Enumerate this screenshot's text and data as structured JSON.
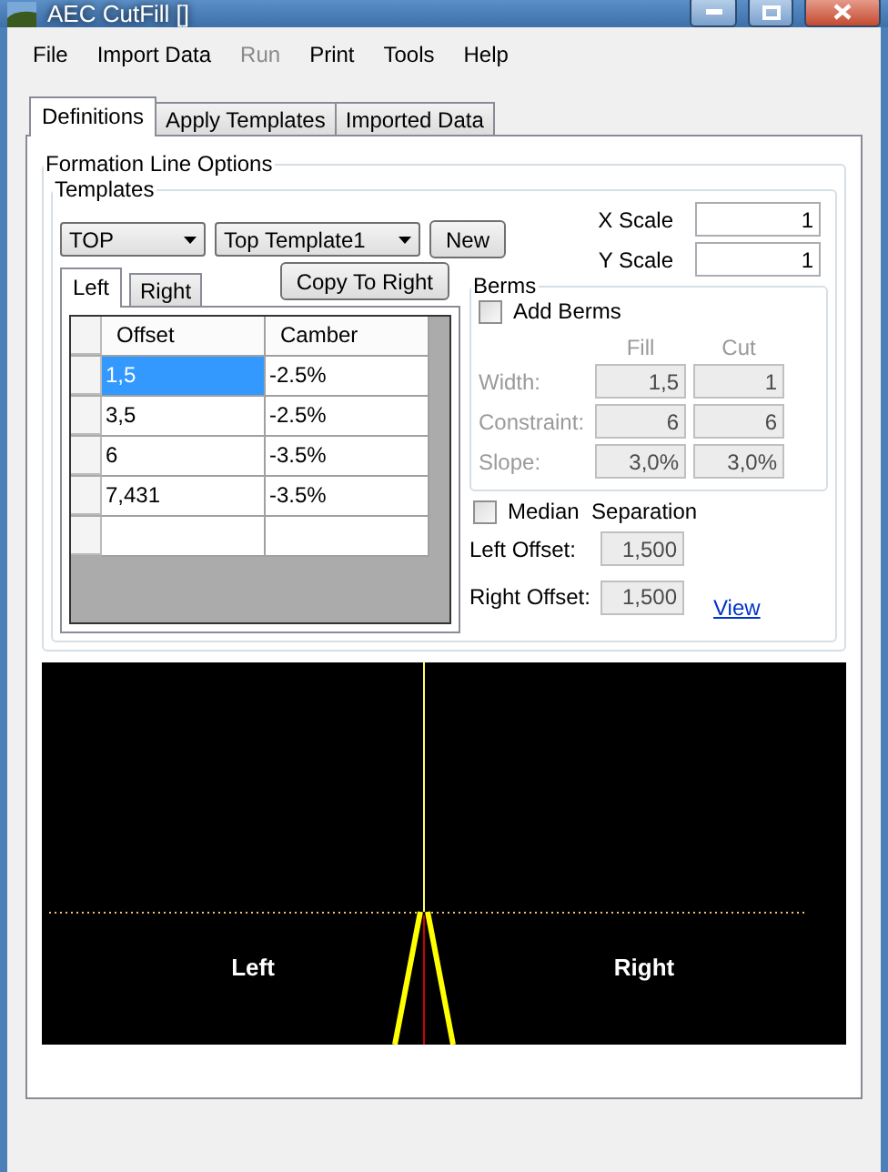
{
  "window": {
    "title": "AEC CutFill []"
  },
  "menu": [
    {
      "label": "File",
      "disabled": false
    },
    {
      "label": "Import Data",
      "disabled": false
    },
    {
      "label": "Run",
      "disabled": true
    },
    {
      "label": "Print",
      "disabled": false
    },
    {
      "label": "Tools",
      "disabled": false
    },
    {
      "label": "Help",
      "disabled": false
    }
  ],
  "tabs": [
    {
      "label": "Definitions",
      "selected": true
    },
    {
      "label": "Apply Templates",
      "selected": false
    },
    {
      "label": "Imported Data",
      "selected": false
    }
  ],
  "formation": {
    "title": "Formation Line Options",
    "templates": {
      "title": "Templates",
      "template_type": "TOP",
      "template_name": "Top Template1",
      "new_button": "New",
      "scales": [
        {
          "label": "X Scale",
          "value": "1"
        },
        {
          "label": "Y Scale",
          "value": "1"
        }
      ],
      "side_tabs": [
        {
          "label": "Left",
          "selected": true
        },
        {
          "label": "Right",
          "selected": false
        }
      ],
      "copy_button": "Copy To Right",
      "grid": {
        "columns": [
          "Offset",
          "Camber"
        ],
        "rows": [
          {
            "cells": [
              "1,5",
              "-2.5%"
            ],
            "selected": true
          },
          {
            "cells": [
              "3,5",
              "-2.5%"
            ],
            "selected": false
          },
          {
            "cells": [
              "6",
              "-3.5%"
            ],
            "selected": false
          },
          {
            "cells": [
              "7,431",
              "-3.5%"
            ],
            "selected": false
          }
        ]
      },
      "berms": {
        "title": "Berms",
        "add_berms": {
          "label": "Add Berms",
          "checked": false
        },
        "disabled": true,
        "columns": [
          "Fill",
          "Cut"
        ],
        "rows": [
          {
            "label": "Width:",
            "fill": "1,5",
            "cut": "1"
          },
          {
            "label": "Constraint:",
            "fill": "6",
            "cut": "6"
          },
          {
            "label": "Slope:",
            "fill": "3,0%",
            "cut": "3,0%"
          }
        ]
      },
      "median": {
        "label": "Median  Separation",
        "checked": false
      },
      "offsets": [
        {
          "label": "Left Offset:",
          "value": "1,500",
          "disabled": true
        },
        {
          "label": "Right Offset:",
          "value": "1,500",
          "disabled": true
        }
      ],
      "view_link": "View"
    }
  },
  "preview": {
    "left_label": "Left",
    "right_label": "Right"
  }
}
